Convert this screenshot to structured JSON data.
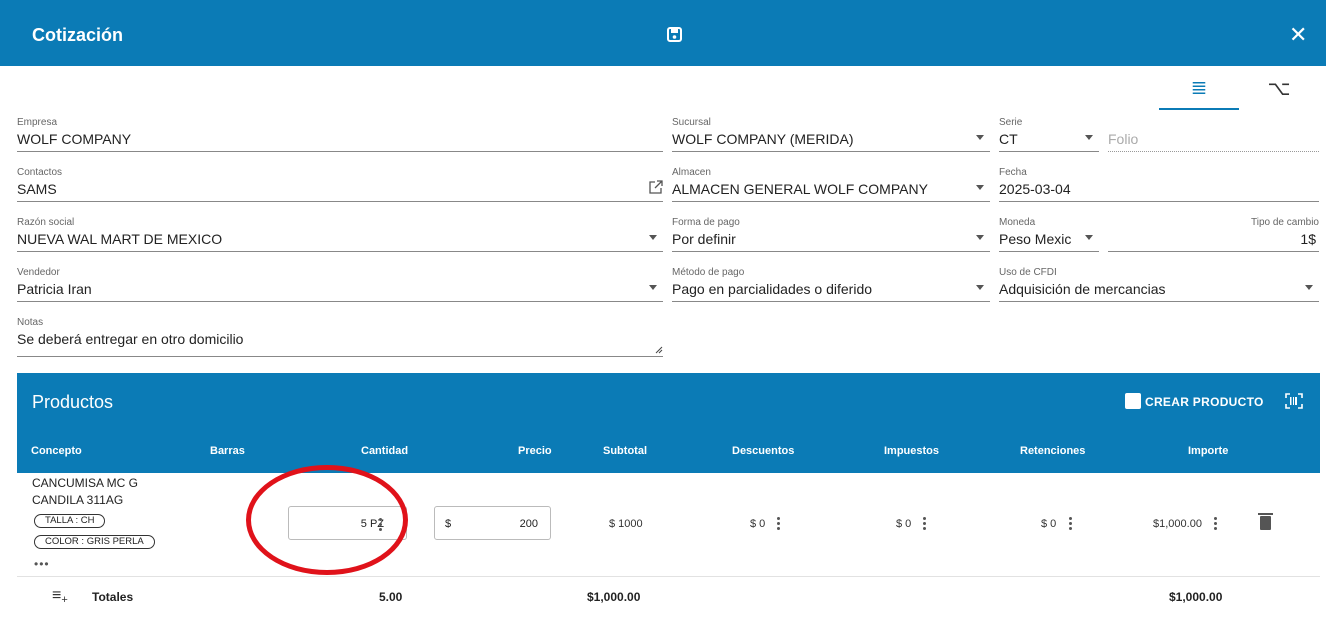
{
  "header": {
    "title": "Cotización",
    "close": "✕"
  },
  "view_tabs": {
    "list_glyph": "≣",
    "options_glyph": "⌥"
  },
  "form": {
    "empresa": {
      "label": "Empresa",
      "value": "WOLF COMPANY"
    },
    "sucursal": {
      "label": "Sucursal",
      "value": "WOLF COMPANY (MERIDA)"
    },
    "serie": {
      "label": "Serie",
      "value": "CT"
    },
    "folio": {
      "placeholder": "Folio"
    },
    "contactos": {
      "label": "Contactos",
      "value": "SAMS"
    },
    "almacen": {
      "label": "Almacen",
      "value": "ALMACEN GENERAL WOLF COMPANY"
    },
    "fecha": {
      "label": "Fecha",
      "value": "2025-03-04"
    },
    "razon_social": {
      "label": "Razón social",
      "value": "NUEVA WAL MART DE MEXICO"
    },
    "forma_pago": {
      "label": "Forma de pago",
      "value": "Por definir"
    },
    "moneda": {
      "label": "Moneda",
      "value": "Peso Mexic"
    },
    "tipo_cambio": {
      "label": "Tipo de cambio",
      "value": "1$"
    },
    "vendedor": {
      "label": "Vendedor",
      "value": "Patricia Iran"
    },
    "metodo_pago": {
      "label": "Método de pago",
      "value": "Pago en parcialidades o diferido"
    },
    "uso_cfdi": {
      "label": "Uso de CFDI",
      "value": "Adquisición de mercancias"
    },
    "notas": {
      "label": "Notas",
      "value": "Se deberá entregar en otro domicilio"
    }
  },
  "productos": {
    "title": "Productos",
    "crear_label": "CREAR PRODUCTO",
    "columns": [
      "Concepto",
      "Barras",
      "Cantidad",
      "Precio",
      "Subtotal",
      "Descuentos",
      "Impuestos",
      "Retenciones",
      "Importe"
    ],
    "row": {
      "concept_line1": "CANCUMISA MC G",
      "concept_line2": "CANDILA 311AG",
      "chips": [
        "TALLA : CH",
        "COLOR : GRIS PERLA"
      ],
      "more": "•••",
      "cantidad": "5 PZ",
      "precio_symbol": "$",
      "precio": "200",
      "subtotal": "$ 1000",
      "descuentos": "$ 0",
      "impuestos": "$ 0",
      "retenciones": "$ 0",
      "importe": "$1,000.00"
    },
    "totals": {
      "label": "Totales",
      "cantidad": "5.00",
      "subtotal": "$1,000.00",
      "importe": "$1,000.00"
    }
  },
  "colors": {
    "primary": "#0b7bb6",
    "annotation": "#e0121a"
  }
}
